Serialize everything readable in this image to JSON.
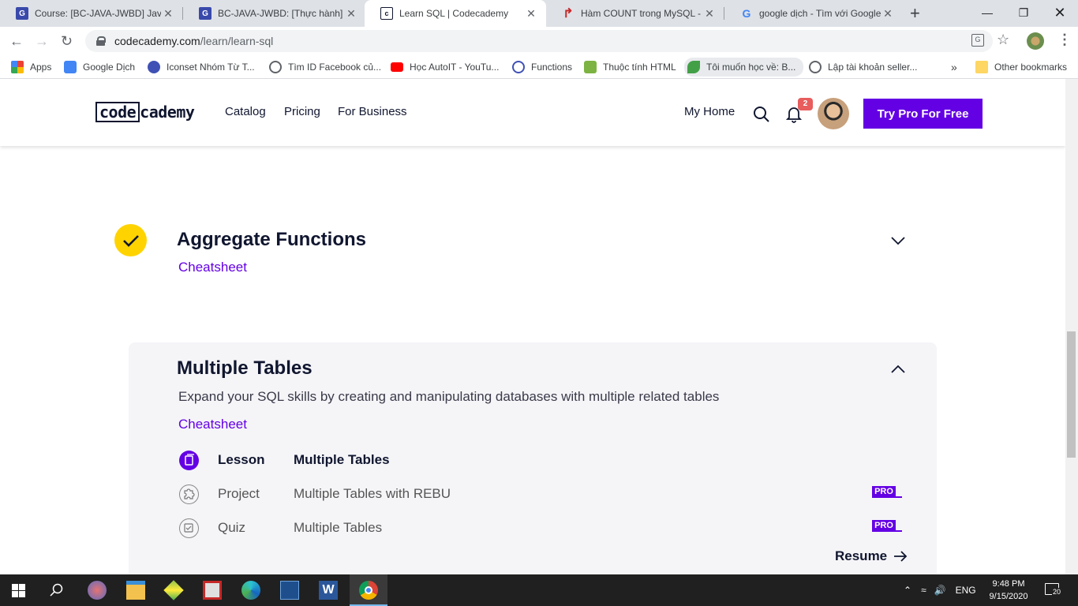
{
  "browser": {
    "tabs": [
      {
        "title": "Course: [BC-JAVA-JWBD] Java V",
        "favicon_letter": "G",
        "favicon_color": "#3949ab"
      },
      {
        "title": "BC-JAVA-JWBD: [Thực hành] Cá",
        "favicon_letter": "G",
        "favicon_color": "#3949ab"
      },
      {
        "title": "Learn SQL | Codecademy",
        "favicon_letter": "c",
        "favicon_color": "#10162f",
        "active": true
      },
      {
        "title": "Hàm COUNT trong MySQL - Fr",
        "favicon_letter": "↱",
        "favicon_color": "#c62828"
      },
      {
        "title": "google dịch - Tìm với Google",
        "favicon_letter": "G",
        "favicon_color": "#4285f4"
      }
    ],
    "url_domain": "codecademy.com",
    "url_path": "/learn/learn-sql",
    "bookmarks": [
      {
        "label": "Apps",
        "icon": "apps-grid-icon"
      },
      {
        "label": "Google Dịch",
        "icon": "google-translate-icon"
      },
      {
        "label": "Iconset Nhóm Từ T...",
        "icon": "iconset-icon"
      },
      {
        "label": "Tìm ID Facebook củ...",
        "icon": "globe-icon"
      },
      {
        "label": "Học AutoIT - YouTu...",
        "icon": "youtube-icon"
      },
      {
        "label": "Functions",
        "icon": "functions-icon"
      },
      {
        "label": "Thuộc tính HTML",
        "icon": "html-icon"
      },
      {
        "label": "Tôi muốn học về: B...",
        "icon": "leaf-icon"
      },
      {
        "label": "Lập tài khoản seller...",
        "icon": "globe-icon"
      }
    ],
    "overflow": "»",
    "other_bookmarks": "Other bookmarks"
  },
  "site": {
    "logo": {
      "left": "code",
      "right": "cademy"
    },
    "nav": [
      "Catalog",
      "Pricing",
      "For Business"
    ],
    "my_home": "My Home",
    "notifications": "2",
    "cta": "Try Pro For Free",
    "accent": "#6400e4"
  },
  "modules": {
    "aggregate": {
      "title": "Aggregate Functions",
      "cheatsheet": "Cheatsheet"
    },
    "multiple": {
      "title": "Multiple Tables",
      "description": "Expand your SQL skills by creating and manipulating databases with multiple related tables",
      "cheatsheet": "Cheatsheet",
      "items": [
        {
          "type": "Lesson",
          "name": "Multiple Tables",
          "pro": false
        },
        {
          "type": "Project",
          "name": "Multiple Tables with REBU",
          "pro": true
        },
        {
          "type": "Quiz",
          "name": "Multiple Tables",
          "pro": true
        }
      ],
      "pro_label": "PRO",
      "resume": "Resume"
    }
  },
  "taskbar": {
    "language": "ENG",
    "time": "9:48 PM",
    "date": "9/15/2020",
    "notifications": "20"
  }
}
